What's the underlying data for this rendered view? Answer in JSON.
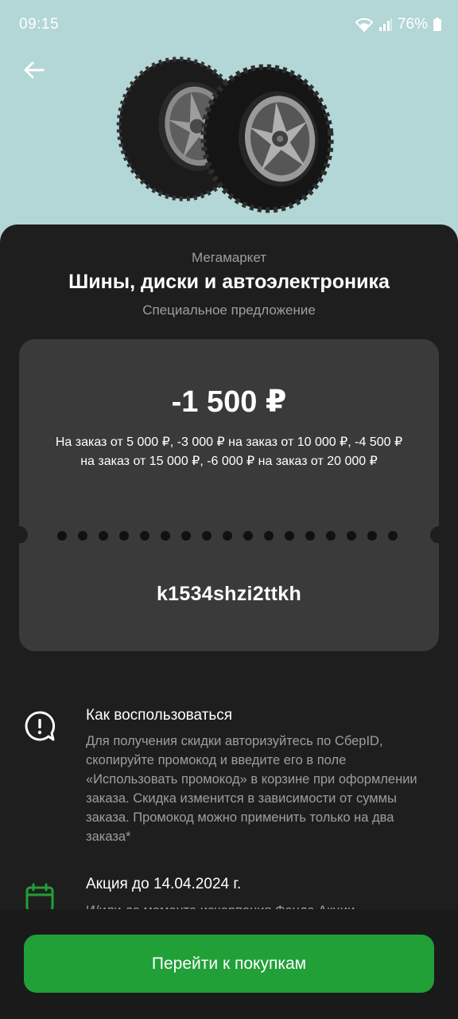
{
  "status_bar": {
    "time": "09:15",
    "battery_percent": "76%",
    "icons": [
      "wifi-icon",
      "signal-icon",
      "battery-icon"
    ]
  },
  "header": {
    "back_icon": "arrow-left-icon",
    "hero_image": "tires-image"
  },
  "offer": {
    "merchant": "Мегамаркет",
    "title": "Шины, диски и автоэлектроника",
    "subtitle": "Специальное предложение",
    "discount": "-1 500 ₽",
    "conditions": "На заказ от 5 000 ₽, -3 000 ₽ на заказ от 10 000 ₽, -4 500 ₽ на заказ от 15 000 ₽, -6 000 ₽ на заказ от 20 000 ₽",
    "promo_code": "k1534shzi2ttkh"
  },
  "info": {
    "how_to": {
      "icon": "info-bubble-icon",
      "title": "Как воспользоваться",
      "text": "Для получения скидки авторизуйтесь по СберID, скопируйте промокод и введите его в поле «Использовать промокод» в корзине при оформлении заказа. Скидка изменится в зависимости от суммы заказа. Промокод можно применить только на два заказа*"
    },
    "validity": {
      "icon": "calendar-icon",
      "title": "Акция до 14.04.2024 г.",
      "text": "И/или до момента исчерпания Фонда Акции"
    }
  },
  "cta": {
    "label": "Перейти к покупкам"
  },
  "colors": {
    "background_top": "#b3d6d6",
    "sheet": "#1e1e1e",
    "card": "#3a3a3a",
    "accent_green": "#21a038"
  }
}
